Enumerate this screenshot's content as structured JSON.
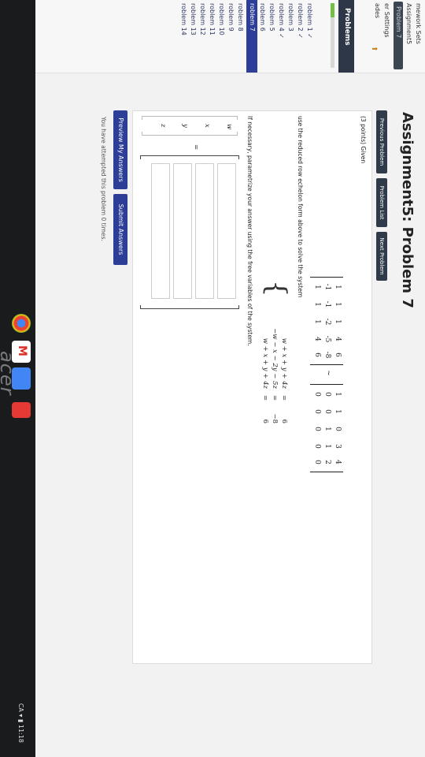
{
  "sidebar": {
    "homework_sets": "mework Sets",
    "assignment": "Assignment5",
    "current_problem_link": "Problem 7",
    "user_settings": "er Settings",
    "grades": "ades"
  },
  "problems_panel": {
    "heading": "Problems",
    "list": [
      {
        "label": "roblem 1 ✓"
      },
      {
        "label": "roblem 2 ✓"
      },
      {
        "label": "roblem 3"
      },
      {
        "label": "roblem 4 ✓"
      },
      {
        "label": "roblem 5"
      },
      {
        "label": "roblem 6"
      },
      {
        "label": "roblem 7"
      },
      {
        "label": "roblem 8"
      },
      {
        "label": "roblem 9"
      },
      {
        "label": "roblem 10"
      },
      {
        "label": "roblem 11"
      },
      {
        "label": "roblem 12"
      },
      {
        "label": "roblem 13"
      },
      {
        "label": "roblem 14"
      }
    ]
  },
  "page_title": "Assignment5: Problem 7",
  "nav_buttons": {
    "previous": "Previous Problem",
    "list": "Problem List",
    "next": "Next Problem"
  },
  "problem": {
    "points": "(3 points) Given",
    "matrix_a": [
      [
        "1",
        "1",
        "1",
        "4",
        "6"
      ],
      [
        "-1",
        "-1",
        "-2",
        "-5",
        "-8"
      ],
      [
        "1",
        "1",
        "1",
        "4",
        "6"
      ]
    ],
    "tilde": "~",
    "matrix_b": [
      [
        "1",
        "1",
        "0",
        "3",
        "4"
      ],
      [
        "0",
        "0",
        "1",
        "1",
        "2"
      ],
      [
        "0",
        "0",
        "0",
        "0",
        "0"
      ]
    ],
    "instruction": "use the reduced row echelon form above to solve the system",
    "system": [
      {
        "lhs": "w + x + y + 4z",
        "eq": "=",
        "rhs": "6"
      },
      {
        "lhs": "−w − x − 2y − 5z",
        "eq": "=",
        "rhs": "−8"
      },
      {
        "lhs": "w + x + y + 4z",
        "eq": "=",
        "rhs": "6"
      }
    ],
    "parametrize_note": "If necessary, parametrize your answer using the free variables of the system.",
    "vector_vars": [
      "w",
      "x",
      "y",
      "z"
    ],
    "equals": "="
  },
  "buttons": {
    "preview": "Preview My Answers",
    "submit": "Submit Answers"
  },
  "footer_partial": "You have attempted this problem 0 times.",
  "taskbar": {
    "tray_text": "CA ▾ ▮ 11:18"
  },
  "bezel_logo": "acer",
  "colors": {
    "accent": "#2c3e98",
    "nav_dark": "#2f3a4a",
    "grade_green": "#74c043"
  }
}
